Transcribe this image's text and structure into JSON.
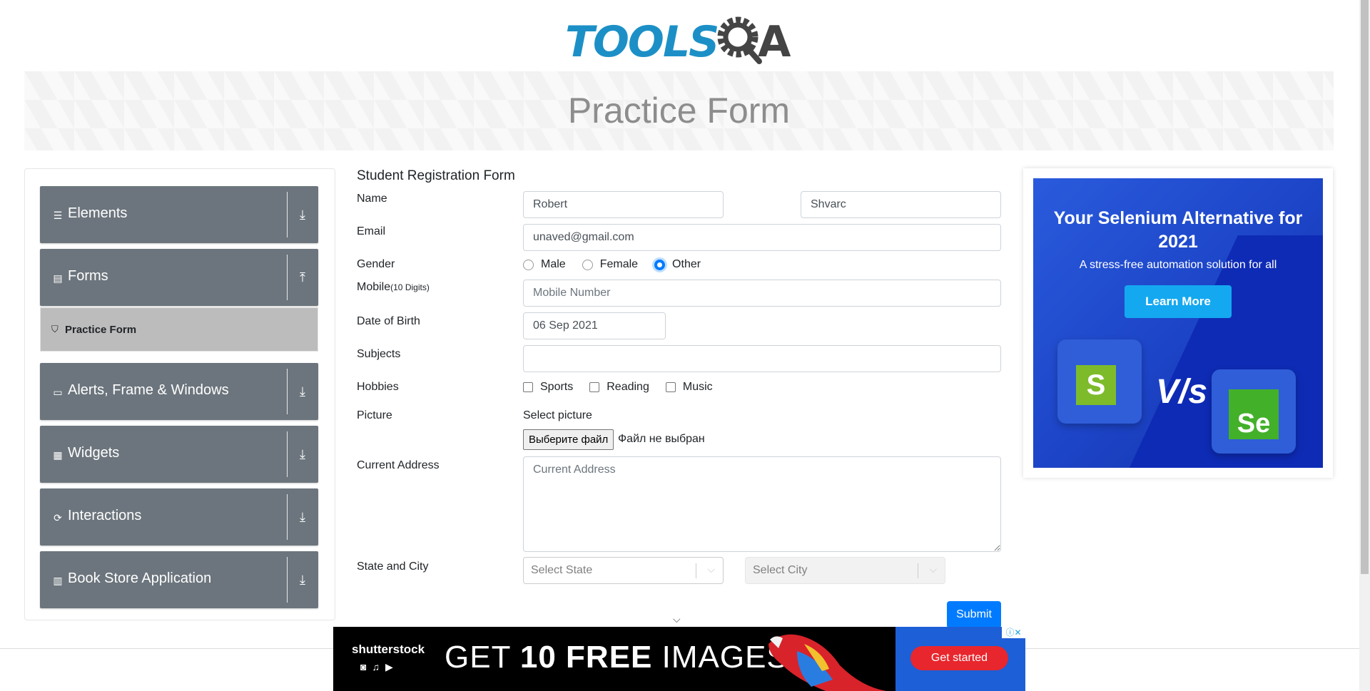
{
  "logo": {
    "main": "TOOLS",
    "end": "A"
  },
  "banner": {
    "title": "Practice Form"
  },
  "sidebar": {
    "groups": [
      {
        "label": "Elements",
        "icon": "menu-icon",
        "arrow": "download-icon"
      },
      {
        "label": "Forms",
        "icon": "document-icon",
        "arrow": "upload-icon"
      },
      {
        "label": "Alerts, Frame & Windows",
        "icon": "window-icon",
        "arrow": "download-icon"
      },
      {
        "label": "Widgets",
        "icon": "grid-icon",
        "arrow": "download-icon"
      },
      {
        "label": "Interactions",
        "icon": "refresh-icon",
        "arrow": "download-icon"
      },
      {
        "label": "Book Store Application",
        "icon": "books-icon",
        "arrow": "download-icon"
      }
    ],
    "active_item": {
      "label": "Practice Form",
      "icon": "html5-icon"
    }
  },
  "form": {
    "title": "Student Registration Form",
    "name_label": "Name",
    "first_name": "Robert",
    "last_name": "Shvarc",
    "email_label": "Email",
    "email": "unaved@gmail.com",
    "gender_label": "Gender",
    "gender_options": [
      "Male",
      "Female",
      "Other"
    ],
    "gender_selected": "Other",
    "mobile_label": "Mobile",
    "mobile_hint": "(10 Digits)",
    "mobile_placeholder": "Mobile Number",
    "mobile_value": "",
    "dob_label": "Date of Birth",
    "dob": "06 Sep 2021",
    "subjects_label": "Subjects",
    "subjects_value": "",
    "hobbies_label": "Hobbies",
    "hobbies": [
      "Sports",
      "Reading",
      "Music"
    ],
    "picture_label": "Picture",
    "picture_prompt": "Select picture",
    "file_button": "Выберите файл",
    "file_status": "Файл не выбран",
    "address_label": "Current Address",
    "address_placeholder": "Current Address",
    "state_city_label": "State and City",
    "state_placeholder": "Select State",
    "city_placeholder": "Select City",
    "submit": "Submit"
  },
  "side_ad": {
    "headline": "Your Selenium Alternative for 2021",
    "subline": "A stress-free automation solution for all",
    "cta": "Learn More",
    "vs": "V/s",
    "logo_left": "S",
    "logo_right": "Se"
  },
  "bottom_ad": {
    "brand": "shutterstock",
    "headline_prefix": "GET ",
    "headline_bold": "10 FREE",
    "headline_suffix": " IMAGES",
    "cta": "Get started"
  },
  "colors": {
    "accent": "#007bff",
    "sidebar": "#6c757d",
    "logo_blue": "#1c90c6",
    "active_item": "#bcbcbc"
  }
}
